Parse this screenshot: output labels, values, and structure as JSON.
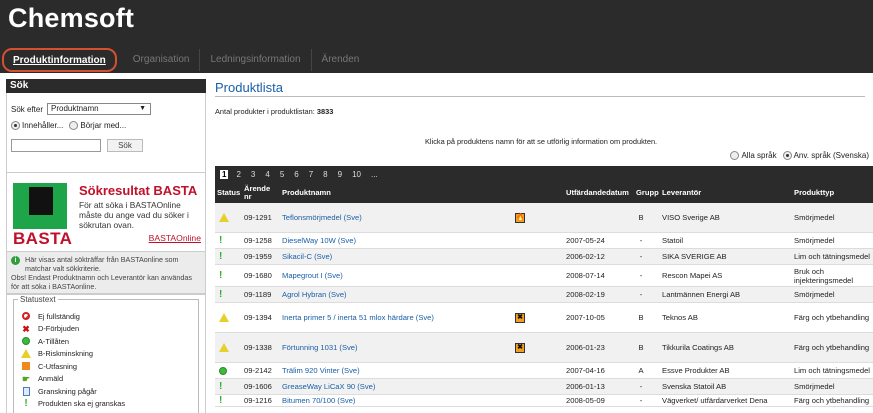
{
  "app": {
    "title": "Chemsoft"
  },
  "nav": {
    "tabs": [
      {
        "label": "Produktinformation",
        "active": true
      },
      {
        "label": "Organisation",
        "active": false
      },
      {
        "label": "Ledningsinformation",
        "active": false
      },
      {
        "label": "Ärenden",
        "active": false
      }
    ]
  },
  "search": {
    "heading": "Sök",
    "search_by_label": "Sök efter",
    "search_by_value": "Produktnamn",
    "radio_contains": "Innehåller...",
    "radio_starts": "Börjar med...",
    "input_value": "",
    "button_label": "Sök"
  },
  "basta": {
    "logo_word": "BASTA",
    "title": "Sökresultat BASTA",
    "text": "För att söka i BASTAOnline måste du ange vad du söker i sökrutan ovan.",
    "link": "BASTAOnline"
  },
  "info": {
    "line1": "Här visas antal sökträffar från BASTAonline som matchar valt sökkriterie.",
    "line2": "Obs! Endast Produktnamn och Leverantör kan användas för att söka i BASTAonline."
  },
  "legend": {
    "title": "Statustext",
    "items": [
      {
        "icon": "forbidden-icon",
        "label": "Ej fullständig"
      },
      {
        "icon": "x-icon",
        "label": "D-Förbjuden"
      },
      {
        "icon": "green-circle-icon",
        "label": "A-Tillåten"
      },
      {
        "icon": "warning-triangle-icon",
        "label": "B-Riskminskning"
      },
      {
        "icon": "orange-square-icon",
        "label": "C-Utfasning"
      },
      {
        "icon": "hand-icon",
        "label": "Anmäld"
      },
      {
        "icon": "document-icon",
        "label": "Granskning pågår"
      },
      {
        "icon": "exclamation-icon",
        "label": "Produkten ska ej granskas"
      }
    ]
  },
  "main": {
    "title": "Produktlista",
    "count_label": "Antal produkter i produktlistan:",
    "count_value": "3833",
    "hint": "Klicka på produktens namn för att se utförlig information om produkten.",
    "lang_all": "Alla språk",
    "lang_user": "Anv. språk (Svenska)",
    "pages": [
      "1",
      "2",
      "3",
      "4",
      "5",
      "6",
      "7",
      "8",
      "9",
      "10",
      "..."
    ],
    "columns": {
      "status": "Status",
      "arende": "Ärende nr",
      "name": "Produktnamn",
      "date": "Utfärdandedatum",
      "group": "Grupp",
      "supplier": "Leverantör",
      "type": "Produkttyp"
    },
    "rows": [
      {
        "status": "warning-triangle-icon",
        "arende": "09-1291",
        "name": "Teflonsmörjmedel (Sve)",
        "hazard": "flame-hazard-icon",
        "hazard_glyph": "🔥",
        "date": "",
        "group": "B",
        "supplier": "VISO Sverige AB",
        "type": "Smörjmedel"
      },
      {
        "status": "exclamation-icon",
        "arende": "09-1258",
        "name": "DieselWay 10W (Sve)",
        "hazard": "",
        "hazard_glyph": "",
        "date": "2007-05-24",
        "group": "-",
        "supplier": "Statoil",
        "type": "Smörjmedel"
      },
      {
        "status": "exclamation-icon",
        "arende": "09-1959",
        "name": "Sikacil-C (Sve)",
        "hazard": "",
        "hazard_glyph": "",
        "date": "2006-02-12",
        "group": "-",
        "supplier": "SIKA SVERIGE AB",
        "type": "Lim och tätningsmedel"
      },
      {
        "status": "exclamation-icon",
        "arende": "09-1680",
        "name": "Mapegrout I (Sve)",
        "hazard": "",
        "hazard_glyph": "",
        "date": "2008-07-14",
        "group": "-",
        "supplier": "Rescon Mapei AS",
        "type": "Bruk och injekteringsmedel"
      },
      {
        "status": "exclamation-icon",
        "arende": "09-1189",
        "name": "Agrol Hybran (Sve)",
        "hazard": "",
        "hazard_glyph": "",
        "date": "2008-02-19",
        "group": "-",
        "supplier": "Lantmännen Energi AB",
        "type": "Smörjmedel"
      },
      {
        "status": "warning-triangle-icon",
        "arende": "09-1394",
        "name": "Inerta primer 5 / inerta 51 mlox härdare (Sve)",
        "hazard": "harmful-hazard-icon",
        "hazard_glyph": "✖",
        "date": "2007-10-05",
        "group": "B",
        "supplier": "Teknos AB",
        "type": "Färg och ytbehandling"
      },
      {
        "status": "warning-triangle-icon",
        "arende": "09-1338",
        "name": "Förtunning 1031 (Sve)",
        "hazard": "harmful-hazard-icon",
        "hazard_glyph": "✖",
        "date": "2006-01-23",
        "group": "B",
        "supplier": "Tikkurila Coatings AB",
        "type": "Färg och ytbehandling"
      },
      {
        "status": "green-circle-icon",
        "arende": "09-2142",
        "name": "Trälim 920 Vinter (Sve)",
        "hazard": "",
        "hazard_glyph": "",
        "date": "2007-04-16",
        "group": "A",
        "supplier": "Essve Produkter AB",
        "type": "Lim och tätningsmedel"
      },
      {
        "status": "exclamation-icon",
        "arende": "09-1606",
        "name": "GreaseWay LiCaX 90 (Sve)",
        "hazard": "",
        "hazard_glyph": "",
        "date": "2006-01-13",
        "group": "-",
        "supplier": "Svenska Statoil AB",
        "type": "Smörjmedel"
      },
      {
        "status": "exclamation-icon",
        "arende": "09-1216",
        "name": "Bitumen 70/100 (Sve)",
        "hazard": "",
        "hazard_glyph": "",
        "date": "2008-05-09",
        "group": "-",
        "supplier": "Vägverket/ utfärdarverket Dena",
        "type": "Färg och ytbehandling"
      }
    ]
  }
}
